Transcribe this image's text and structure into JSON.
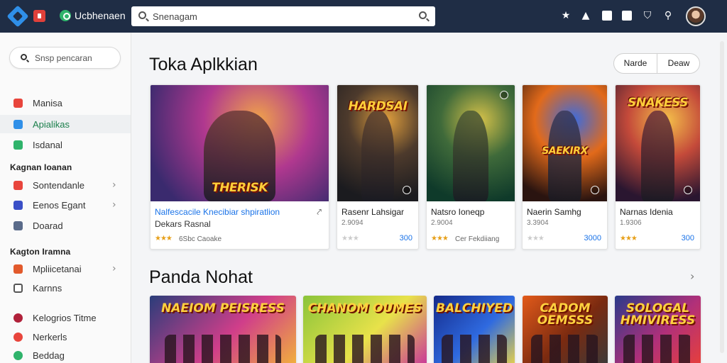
{
  "topbar": {
    "brand_name": "Ucbhenaen",
    "search_placeholder": "Snenagam",
    "icons": [
      "star-icon",
      "arrow-up-icon",
      "settings-icon",
      "bookmark-icon",
      "shield-icon",
      "search-icon"
    ]
  },
  "sidebar": {
    "search_placeholder": "Snsp pencaran",
    "top_items": [
      {
        "label": "Manisa",
        "color": "#e8453c",
        "active": false
      },
      {
        "label": "Apialikas",
        "color": "#2f8fe8",
        "active": true
      },
      {
        "label": "Isdanal",
        "color": "#2fb36b",
        "active": false
      }
    ],
    "section1_title": "Kagnan Ioanan",
    "section1_items": [
      {
        "label": "Sontendanle",
        "color": "#e8453c"
      },
      {
        "label": "Eenos Egant",
        "color": "#3a4fc7"
      },
      {
        "label": "Doarad",
        "color": "#5a6b8a"
      }
    ],
    "section2_title": "Kagton Iramna",
    "section2_items": [
      {
        "label": "Mpliicetanai",
        "color": "#e25a2c"
      },
      {
        "label": "Karnns",
        "color": "#555555"
      }
    ],
    "bottom_items": [
      {
        "label": "Kelogrios Titme",
        "color": "#b0213a"
      },
      {
        "label": "Nerkerls",
        "color": "#e8453c"
      },
      {
        "label": "Beddag",
        "color": "#2fb36b"
      }
    ]
  },
  "main": {
    "title": "Toka Aplkkian",
    "segment": {
      "left": "Narde",
      "right": "Deaw"
    },
    "cards": [
      {
        "name": "Nalfescacile Knecibiar shpiratlion",
        "sub": "Dekars Rasnal",
        "stars": 3,
        "meta": "6Sbc Caoake",
        "price": "",
        "art_title": "THERISK",
        "bg": [
          "#3a2a6e",
          "#b0388f",
          "#f0a34a"
        ],
        "hero": "#6b3a3a"
      },
      {
        "name": "Rasenr Lahsigar",
        "sub": "2.9094",
        "stars": 0,
        "meta": "",
        "price": "300",
        "art_title": "HARDSAI",
        "bg": [
          "#1b1b1f",
          "#4d3a2c",
          "#e2a03d"
        ],
        "hero": "#5a4030"
      },
      {
        "name": "Natsro Ioneqp",
        "sub": "2.9004",
        "stars": 3,
        "meta": "Cer Fekdiiang",
        "price": "",
        "art_title": "",
        "bg": [
          "#0f3a2a",
          "#3f6a3a",
          "#d6c24a"
        ],
        "hero": "#4d5a35"
      },
      {
        "name": "Naerin Samhg",
        "sub": "3.3904",
        "stars": 0,
        "meta": "",
        "price": "3000",
        "art_title": "SAEKIRX",
        "bg": [
          "#2a1410",
          "#e26a1a",
          "#3a6be0"
        ],
        "hero": "#3a3a5a"
      },
      {
        "name": "Narnas Idenia",
        "sub": "1.9306",
        "stars": 3,
        "meta": "",
        "price": "300",
        "art_title": "SNAKESS",
        "bg": [
          "#2a1630",
          "#c44a3a",
          "#f5c14a"
        ],
        "hero": "#6b2f3a"
      }
    ],
    "section2_title": "Panda Nohat",
    "tiles": [
      {
        "art_title": "NAEIOM PEISRESS",
        "bg": [
          "#2a3d7a",
          "#d03e8a",
          "#f2b23a"
        ]
      },
      {
        "art_title": "CHANOM OUMES",
        "bg": [
          "#8ac43a",
          "#e8e24a",
          "#c9349a"
        ]
      },
      {
        "art_title": "BALCHIYED",
        "bg": [
          "#142a8a",
          "#2f6ae0",
          "#e8d24a"
        ]
      },
      {
        "art_title": "CADOM OEMSSS",
        "bg": [
          "#e25a1a",
          "#7a2a10",
          "#3a3a3a"
        ]
      },
      {
        "art_title": "SOLOGAL HMIVIRESS",
        "bg": [
          "#2a3a8a",
          "#b0307a",
          "#e8403a"
        ]
      }
    ]
  }
}
